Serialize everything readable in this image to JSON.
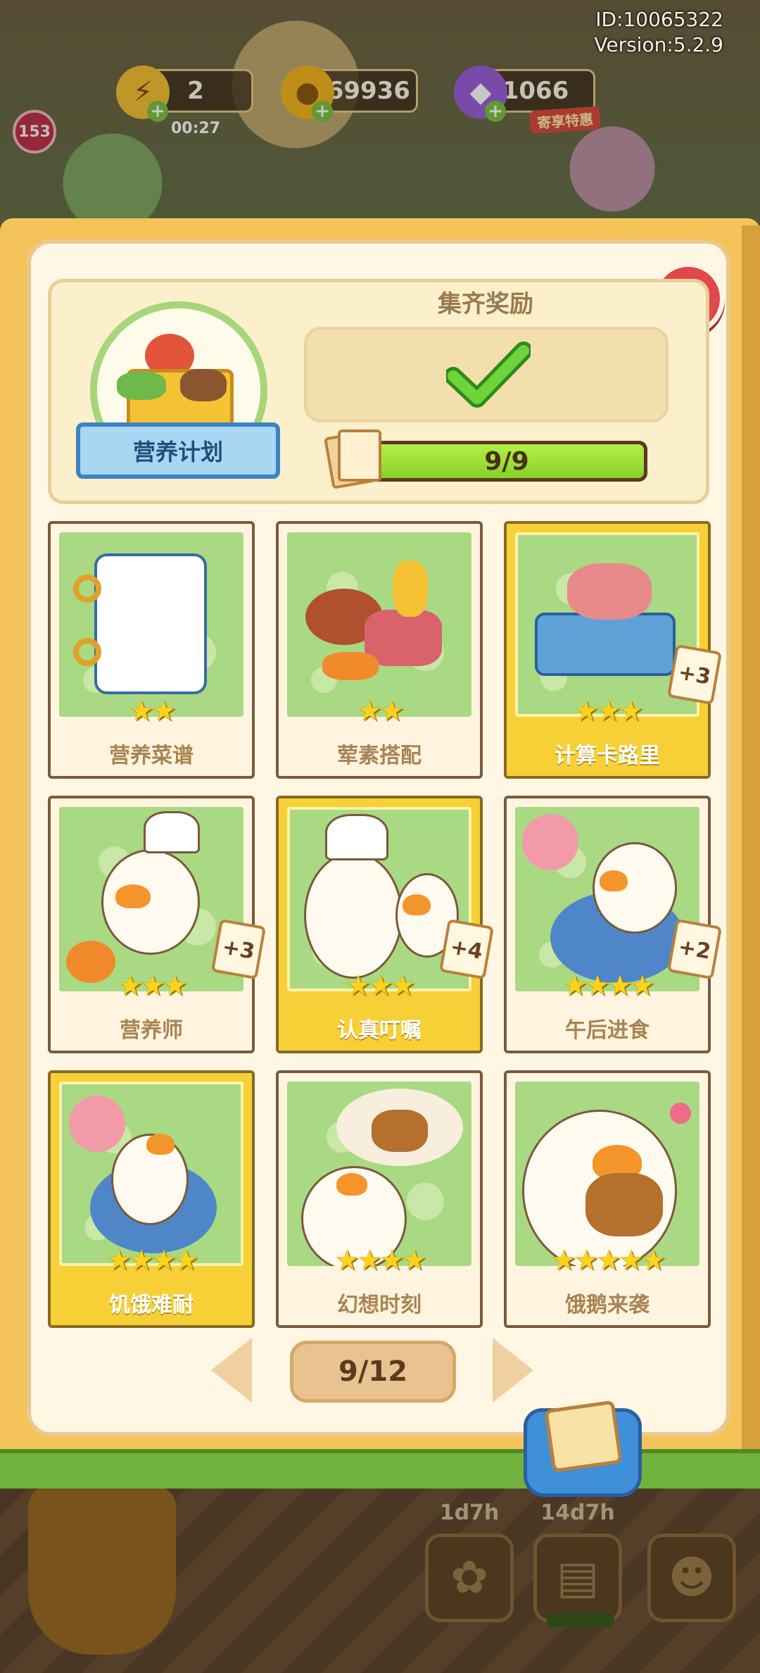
{
  "hud": {
    "id_text": "ID:10065322",
    "version_text": "Version:5.2.9",
    "level_badge": "153",
    "energy": {
      "value": "2",
      "timer": "00:27"
    },
    "coins": {
      "value": "469936"
    },
    "gems": {
      "value": "1066",
      "tag": "寄享特惠"
    }
  },
  "set": {
    "name": "营养计划",
    "reward_title": "集齐奖励",
    "progress_text": "9/9",
    "progress_fraction": 1.0,
    "reward_claimed": true
  },
  "cards": [
    {
      "label": "营养菜谱",
      "stars": "★★",
      "gold": false,
      "plus": ""
    },
    {
      "label": "荤素搭配",
      "stars": "★★",
      "gold": false,
      "plus": ""
    },
    {
      "label": "计算卡路里",
      "stars": "★★★",
      "gold": true,
      "plus": "+3"
    },
    {
      "label": "营养师",
      "stars": "★★★",
      "gold": false,
      "plus": "+3"
    },
    {
      "label": "认真叮嘱",
      "stars": "★★★",
      "gold": true,
      "plus": "+4"
    },
    {
      "label": "午后进食",
      "stars": "★★★★",
      "gold": false,
      "plus": "+2"
    },
    {
      "label": "饥饿难耐",
      "stars": "★★★★",
      "gold": true,
      "plus": ""
    },
    {
      "label": "幻想时刻",
      "stars": "★★★★",
      "gold": false,
      "plus": ""
    },
    {
      "label": "饿鹅来袭",
      "stars": "★★★★★",
      "gold": false,
      "plus": ""
    }
  ],
  "pagination": {
    "current": "9/12"
  },
  "bottom_bar": {
    "timer_1": "1d7h",
    "timer_2": "14d7h"
  },
  "colors": {
    "close_red": "#e2474a",
    "progress_green": "#86d12a",
    "gold_card": "#f6d036",
    "ribbon_blue": "#3a84c4"
  }
}
